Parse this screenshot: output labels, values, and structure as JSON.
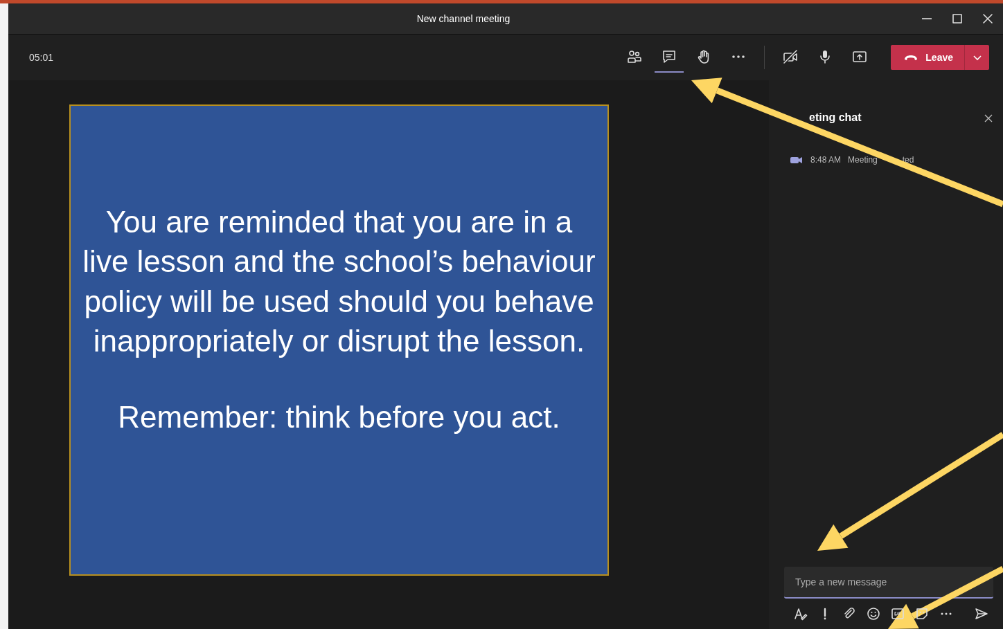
{
  "window": {
    "title": "New channel meeting"
  },
  "toolbar": {
    "timer": "05:01",
    "buttons": [
      {
        "kind": "people",
        "selected": false
      },
      {
        "kind": "chat",
        "selected": true
      },
      {
        "kind": "hand",
        "selected": false
      },
      {
        "kind": "more",
        "selected": false
      }
    ],
    "devices": [
      {
        "kind": "camera",
        "on": false
      },
      {
        "kind": "mic",
        "on": true
      },
      {
        "kind": "share"
      }
    ],
    "leave": "Leave"
  },
  "slide": {
    "paragraphs": [
      "You are reminded that you are in a live lesson and the school’s behaviour policy will be used should you behave inappropriately or disrupt the lesson.",
      "Remember: think before you act."
    ]
  },
  "chat": {
    "title": "eting chat",
    "events": [
      {
        "time": "8:48 AM",
        "text_parts": [
          "Meeting",
          "ted"
        ]
      }
    ],
    "composer": {
      "placeholder": "Type a new message"
    },
    "tools": [
      {
        "kind": "format"
      },
      {
        "kind": "important"
      },
      {
        "kind": "attach"
      },
      {
        "kind": "emoji"
      },
      {
        "kind": "gif"
      },
      {
        "kind": "sticker"
      },
      {
        "kind": "more"
      },
      {
        "kind": "send"
      }
    ]
  }
}
